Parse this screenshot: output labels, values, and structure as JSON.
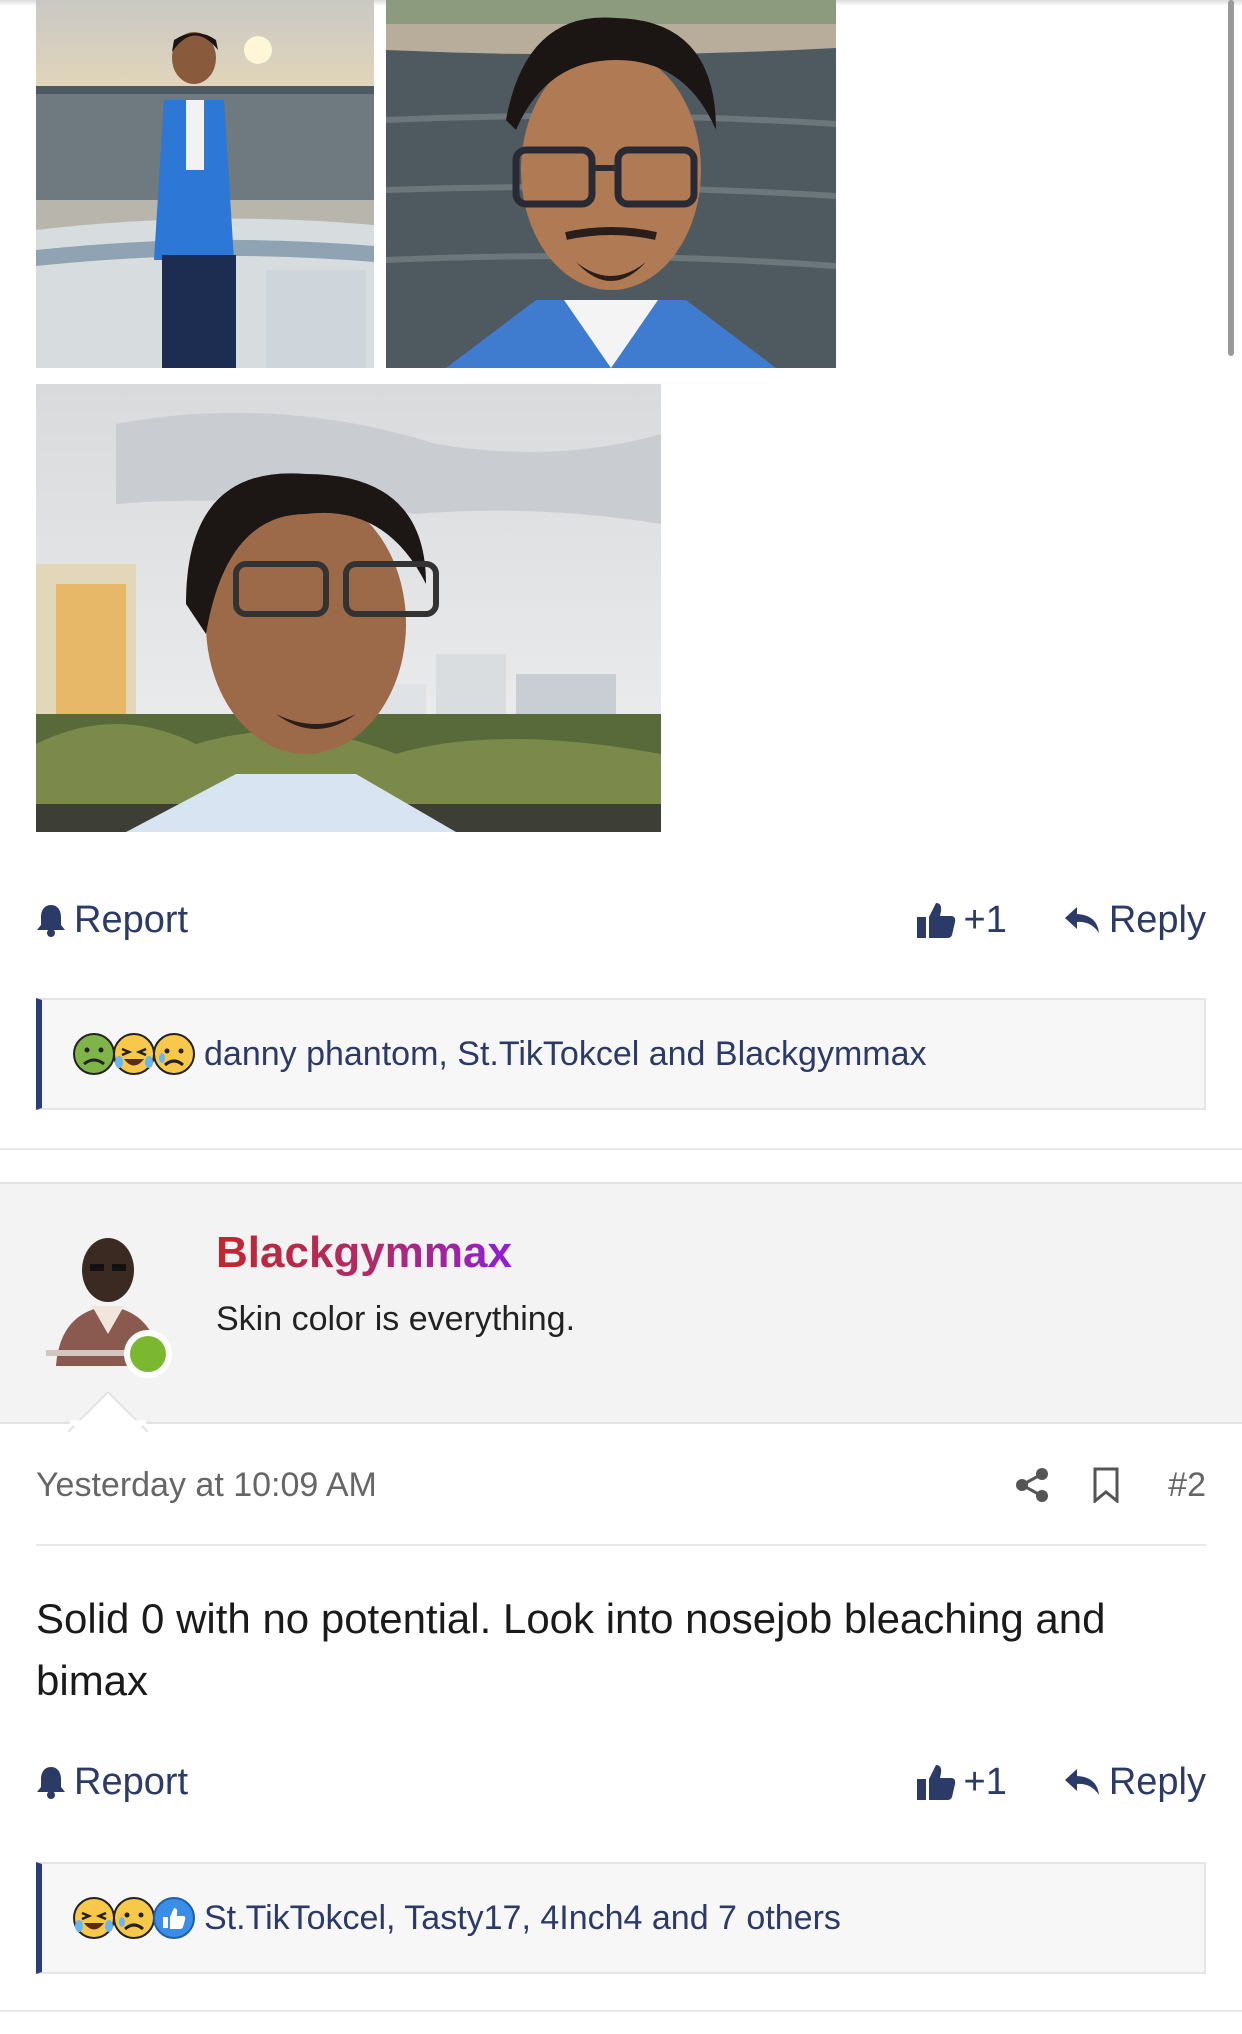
{
  "post1": {
    "photos": [
      {
        "name": "photo-boat-blue-suit",
        "alt": "man in blue suit on a boat at sunset"
      },
      {
        "name": "photo-selfie-water",
        "alt": "selfie with glasses by the water"
      },
      {
        "name": "photo-city-profile",
        "alt": "profile photo with city buildings"
      }
    ],
    "report_label": "Report",
    "like_count": "+1",
    "reply_label": "Reply",
    "reactions": {
      "emoji_icons": [
        "sick-face-icon",
        "laughing-crying-face-icon",
        "sad-face-icon"
      ],
      "text": "danny phantom, St.TikTokcel and Blackgymmax"
    }
  },
  "post2": {
    "author": {
      "username": "Blackgymmax",
      "title": "Skin color is everything.",
      "online": true
    },
    "timestamp": "Yesterday at 10:09 AM",
    "post_number": "#2",
    "body": "Solid 0 with no potential. Look into nosejob bleaching and bimax",
    "report_label": "Report",
    "like_count": "+1",
    "reply_label": "Reply",
    "reactions": {
      "emoji_icons": [
        "laughing-crying-face-icon",
        "sad-face-icon",
        "thumbs-up-icon"
      ],
      "text": "St.TikTokcel, Tasty17, 4Inch4 and 7 others"
    }
  },
  "colors": {
    "link": "#2b3a67",
    "accent_border": "#2a3b80",
    "online": "#7cb82f",
    "username_gradient": [
      "#c0282d",
      "#8f1fd6"
    ]
  }
}
